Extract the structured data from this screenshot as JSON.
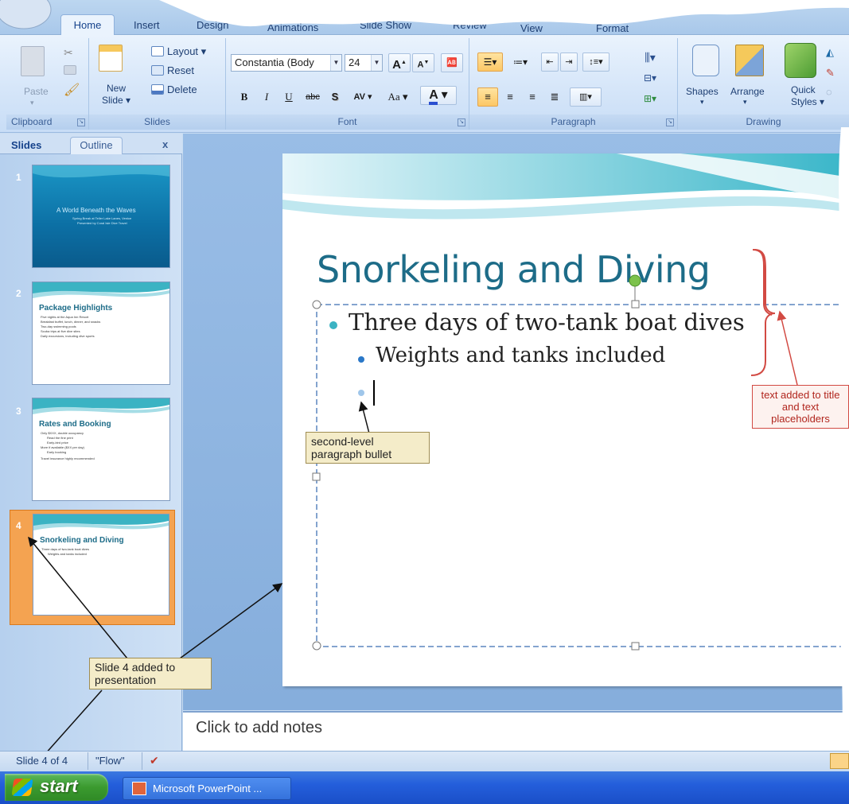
{
  "ribbon_tabs": [
    "Home",
    "Insert",
    "Design",
    "Animations",
    "Slide Show",
    "Review",
    "View",
    "Format"
  ],
  "clipboard": {
    "paste": "Paste",
    "label": "Clipboard"
  },
  "slides_group": {
    "layout": "Layout",
    "reset": "Reset",
    "delete": "Delete",
    "new_slide_1": "New",
    "new_slide_2": "Slide",
    "label": "Slides"
  },
  "font": {
    "name": "Constantia (Body",
    "size": "24",
    "label": "Font",
    "bold": "B",
    "italic": "I",
    "underline": "U",
    "strike": "abc",
    "shadow": "S",
    "spacing": "AV",
    "case": "Aa",
    "color": "A",
    "grow": "A",
    "shrink": "A"
  },
  "paragraph": {
    "label": "Paragraph"
  },
  "drawing": {
    "shapes": "Shapes",
    "arrange": "Arrange",
    "quick_1": "Quick",
    "quick_2": "Styles",
    "label": "Drawing"
  },
  "pane": {
    "tab_slides": "Slides",
    "tab_outline": "Outline",
    "close": "x"
  },
  "thumbnails": [
    {
      "num": "1",
      "title": "A World Beneath the Waves",
      "lines": [
        "Spring Break at Teller Lake Lanes, Venice",
        "Presented by Coral Isle Dive Travel"
      ]
    },
    {
      "num": "2",
      "title": "Package Highlights",
      "lines": [
        "Five nights at the Aqua Inn Resort",
        "Breakfast buffet, lunch, dinner, and snacks",
        "Two-day swimming pools",
        "Scuba trips at five dive sites",
        "Daily excursions, including dive sports"
      ]
    },
    {
      "num": "3",
      "title": "Rates and Booking",
      "lines": [
        "Only $XXX, double occupancy",
        "Read the fine print",
        "Early-bird price",
        "More if available ($XX per day)",
        "Early booking",
        "Travel insurance highly recommended"
      ]
    },
    {
      "num": "4",
      "title": "Snorkeling and Diving",
      "lines": [
        "Three days of two-tank boat dives",
        "Weights and tanks included"
      ]
    }
  ],
  "slide": {
    "title": "Snorkeling and Diving",
    "bullet1": "Three days of two-tank boat dives",
    "bullet2": "Weights and tanks included"
  },
  "notes_placeholder": "Click to add notes",
  "status": {
    "slide_counter": "Slide 4 of 4",
    "theme": "\"Flow\""
  },
  "taskbar": {
    "start": "start",
    "app": "Microsoft PowerPoint ..."
  },
  "callouts": {
    "second_level": "second-level paragraph bullet",
    "text_added": "text added to title and text placeholders",
    "slide_added": "Slide 4 added to presentation"
  },
  "colors": {
    "title_teal": "#1d6c88",
    "accent_red": "#d24a43",
    "selected_orange": "#f4a351",
    "bullet_teal": "#3bb3c3",
    "bullet_blue": "#2a78c8"
  }
}
